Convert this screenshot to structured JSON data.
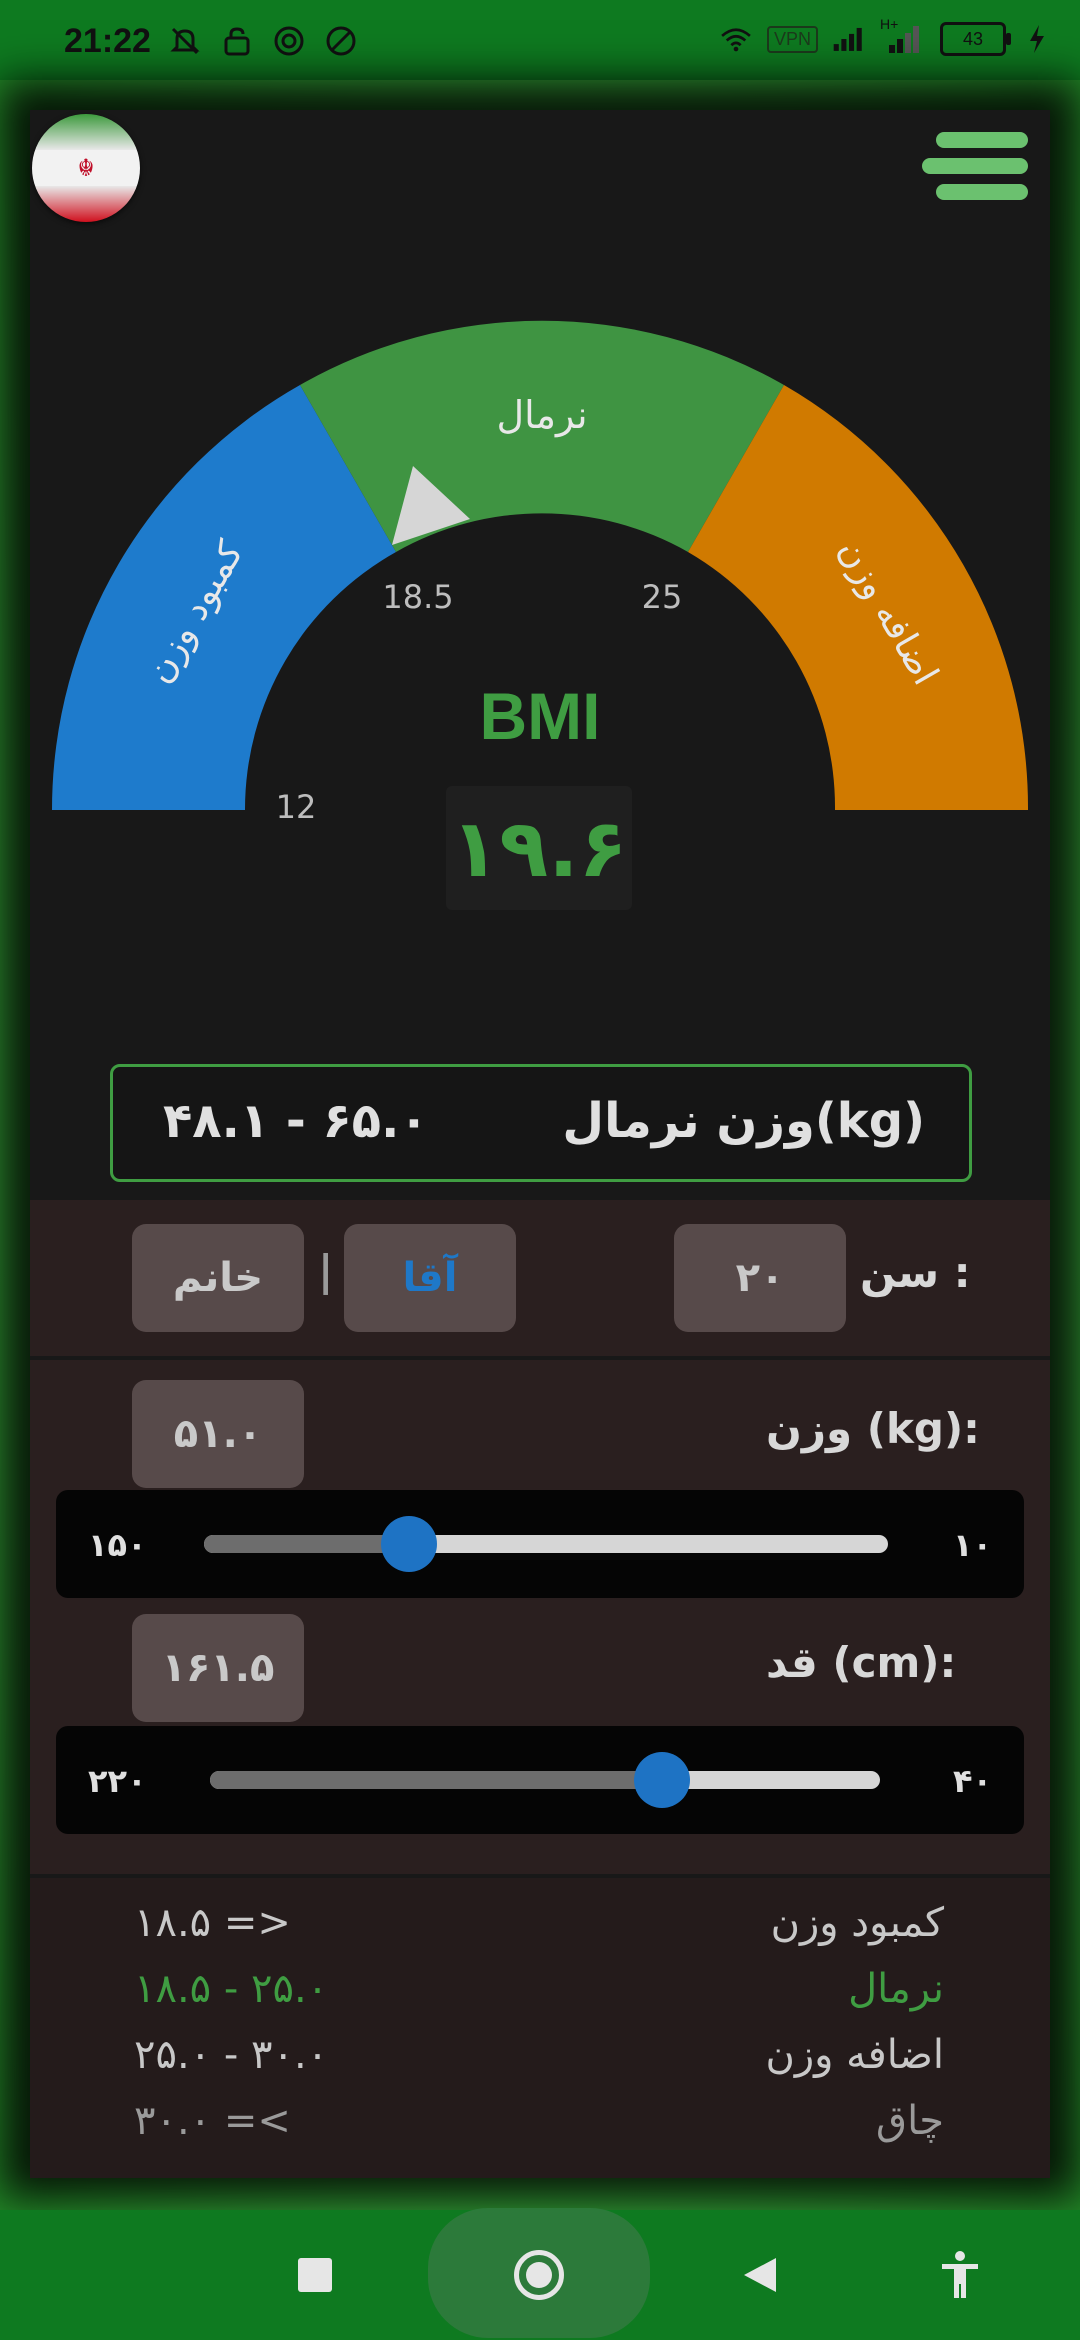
{
  "status_bar": {
    "time": "21:22",
    "vpn": "VPN",
    "network": "H+",
    "battery": "43"
  },
  "gauge": {
    "segments": [
      {
        "label": "کمبود وزن",
        "color": "#1e7bcc"
      },
      {
        "label": "نرمال",
        "color": "#3f9442"
      },
      {
        "label": "اضافه وزن",
        "color": "#d07a00"
      }
    ],
    "ticks": [
      "12",
      "18.5",
      "25"
    ],
    "pointer_bmi": 19.6
  },
  "bmi": {
    "title": "BMI",
    "value": "۱۹.۶"
  },
  "normal_weight": {
    "label": "وزن نرمال(kg)",
    "range": "۴۸.۱ - ۶۵.۰"
  },
  "profile": {
    "age_label": "سن :",
    "age_value": "۲۰",
    "male": "آقا",
    "separator": "|",
    "female": "خانم"
  },
  "weight": {
    "label": "وزن (kg):",
    "value": "۵۱.۰",
    "min": "۱۰",
    "max": "۱۵۰",
    "level_fraction": 0.3
  },
  "height": {
    "label": "قد (cm):",
    "value": "۱۶۱.۵",
    "min": "۴۰",
    "max": "۲۲۰",
    "level_fraction": 0.675
  },
  "legend": [
    {
      "name": "کمبود وزن",
      "value": "۱۸.۵ =>",
      "color": "#c8c8c8"
    },
    {
      "name": "نرمال",
      "value": "۱۸.۵ - ۲۵.۰",
      "color": "#3f9d42"
    },
    {
      "name": "اضافه وزن",
      "value": "۲۵.۰ - ۳۰.۰",
      "color": "#c8c8c8"
    },
    {
      "name": "چاق",
      "value": "۳۰.۰ =<",
      "color": "#9a9a9a"
    }
  ]
}
